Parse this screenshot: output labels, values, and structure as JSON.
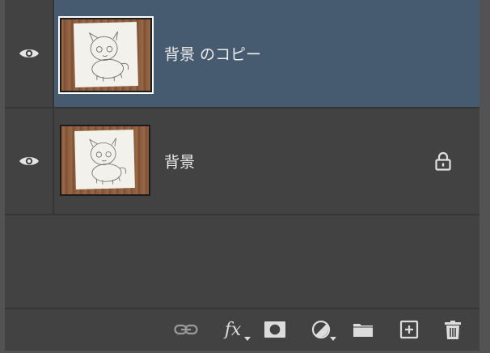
{
  "layers": [
    {
      "name": "背景 のコピー",
      "visible": true,
      "selected": true,
      "locked": false,
      "visibility_icon": "eye-icon"
    },
    {
      "name": "背景",
      "visible": true,
      "selected": false,
      "locked": true,
      "visibility_icon": "eye-icon",
      "lock_icon": "lock-icon"
    }
  ],
  "toolbar": {
    "link_icon": "link-layers-icon",
    "fx_label": "fx",
    "mask_icon": "add-layer-mask-icon",
    "adjustment_icon": "adjustment-layer-icon",
    "group_icon": "folder-icon",
    "new_layer_icon": "new-layer-icon",
    "delete_icon": "trash-icon"
  },
  "colors": {
    "panel_bg": "#424242",
    "selected_row": "#475b70",
    "icon": "#dcdcdc",
    "text": "#ececec"
  }
}
